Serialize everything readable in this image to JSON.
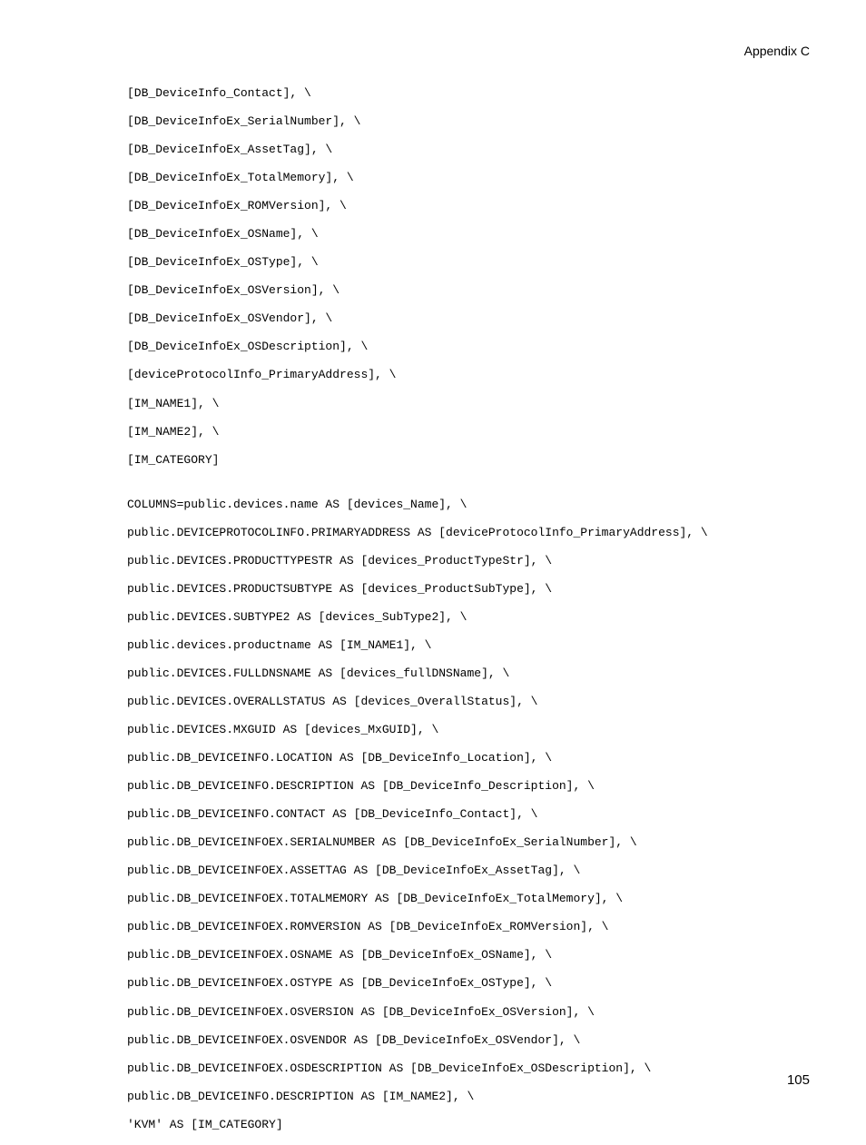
{
  "header": "Appendix C",
  "page_number": "105",
  "lines": [
    "[DB_DeviceInfo_Contact], \\",
    "[DB_DeviceInfoEx_SerialNumber], \\",
    "[DB_DeviceInfoEx_AssetTag], \\",
    "[DB_DeviceInfoEx_TotalMemory], \\",
    "[DB_DeviceInfoEx_ROMVersion], \\",
    "[DB_DeviceInfoEx_OSName], \\",
    "[DB_DeviceInfoEx_OSType], \\",
    "[DB_DeviceInfoEx_OSVersion], \\",
    "[DB_DeviceInfoEx_OSVendor], \\",
    "[DB_DeviceInfoEx_OSDescription], \\",
    "[deviceProtocolInfo_PrimaryAddress], \\",
    "[IM_NAME1], \\",
    "[IM_NAME2], \\",
    "[IM_CATEGORY]",
    "",
    "COLUMNS=public.devices.name AS [devices_Name], \\",
    "public.DEVICEPROTOCOLINFO.PRIMARYADDRESS AS [deviceProtocolInfo_PrimaryAddress], \\",
    "public.DEVICES.PRODUCTTYPESTR AS [devices_ProductTypeStr], \\",
    "public.DEVICES.PRODUCTSUBTYPE AS [devices_ProductSubType], \\",
    "public.DEVICES.SUBTYPE2 AS [devices_SubType2], \\",
    "public.devices.productname AS [IM_NAME1], \\",
    "public.DEVICES.FULLDNSNAME AS [devices_fullDNSName], \\",
    "public.DEVICES.OVERALLSTATUS AS [devices_OverallStatus], \\",
    "public.DEVICES.MXGUID AS [devices_MxGUID], \\",
    "public.DB_DEVICEINFO.LOCATION AS [DB_DeviceInfo_Location], \\",
    "public.DB_DEVICEINFO.DESCRIPTION AS [DB_DeviceInfo_Description], \\",
    "public.DB_DEVICEINFO.CONTACT AS [DB_DeviceInfo_Contact], \\",
    "public.DB_DEVICEINFOEX.SERIALNUMBER AS [DB_DeviceInfoEx_SerialNumber], \\",
    "public.DB_DEVICEINFOEX.ASSETTAG AS [DB_DeviceInfoEx_AssetTag], \\",
    "public.DB_DEVICEINFOEX.TOTALMEMORY AS [DB_DeviceInfoEx_TotalMemory], \\",
    "public.DB_DEVICEINFOEX.ROMVERSION AS [DB_DeviceInfoEx_ROMVersion], \\",
    "public.DB_DEVICEINFOEX.OSNAME AS [DB_DeviceInfoEx_OSName], \\",
    "public.DB_DEVICEINFOEX.OSTYPE AS [DB_DeviceInfoEx_OSType], \\",
    "public.DB_DEVICEINFOEX.OSVERSION AS [DB_DeviceInfoEx_OSVersion], \\",
    "public.DB_DEVICEINFOEX.OSVENDOR AS [DB_DeviceInfoEx_OSVendor], \\",
    "public.DB_DEVICEINFOEX.OSDESCRIPTION AS [DB_DeviceInfoEx_OSDescription], \\",
    "public.DB_DEVICEINFO.DESCRIPTION AS [IM_NAME2], \\",
    "'KVM' AS [IM_CATEGORY]"
  ]
}
